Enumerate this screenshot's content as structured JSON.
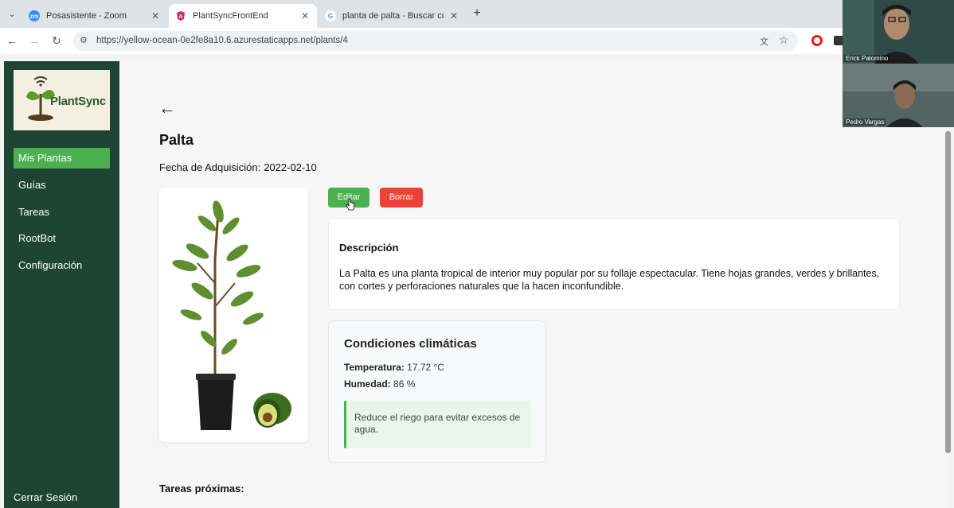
{
  "browser": {
    "tabs": [
      {
        "title": "Posasistente - Zoom",
        "favicon": "zoom-icon"
      },
      {
        "title": "PlantSyncFrontEnd",
        "favicon": "angular-icon"
      },
      {
        "title": "planta de palta - Buscar con Go",
        "favicon": "google-icon"
      }
    ],
    "url": "https://yellow-ocean-0e2fe8a10.6.azurestaticapps.net/plants/4"
  },
  "app": {
    "logo_text": "PlantSync",
    "nav": [
      {
        "label": "Mis Plantas"
      },
      {
        "label": "Guías"
      },
      {
        "label": "Tareas"
      },
      {
        "label": "RootBot"
      },
      {
        "label": "Configuración"
      }
    ],
    "logout": "Cerrar Sesión"
  },
  "plant": {
    "name": "Palta",
    "date_label": "Fecha de Adquisición:",
    "date": "2022-02-10",
    "edit_label": "Editar",
    "delete_label": "Borrar",
    "description_title": "Descripción",
    "description": "La Palta es una planta tropical de interior muy popular por su follaje espectacular. Tiene hojas grandes, verdes y brillantes, con cortes y perforaciones naturales que la hacen inconfundible.",
    "climate_title": "Condiciones climáticas",
    "temp_label": "Temperatura:",
    "temp_value": "17.72 °C",
    "humidity_label": "Humedad:",
    "humidity_value": "86 %",
    "tip": "Reduce el riego para evitar excesos de agua.",
    "upcoming_title": "Tareas próximas:"
  },
  "zoom": {
    "participants": [
      {
        "name": "Erick Palomino"
      },
      {
        "name": "Pedro Vargas"
      }
    ]
  },
  "colors": {
    "sidebar": "#1e4533",
    "accent": "#4caf50",
    "danger": "#ef4135"
  }
}
